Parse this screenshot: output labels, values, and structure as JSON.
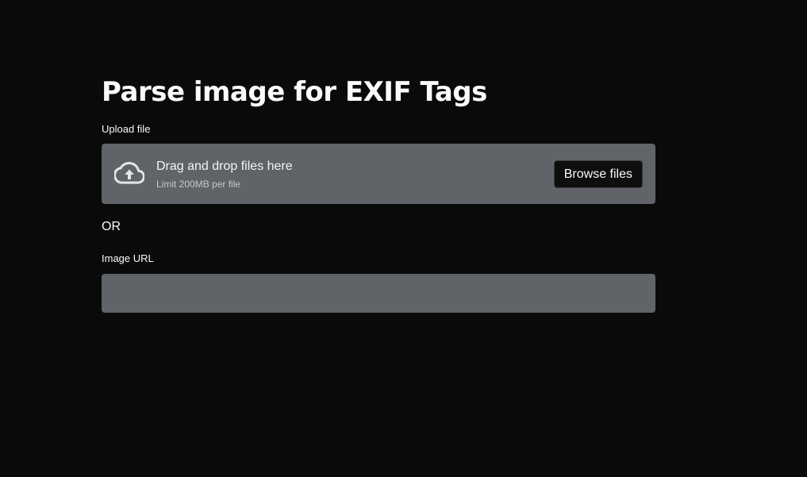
{
  "page": {
    "title": "Parse image for EXIF Tags"
  },
  "upload": {
    "label": "Upload file",
    "dropzone_title": "Drag and drop files here",
    "dropzone_subtitle": "Limit 200MB per file",
    "browse_label": "Browse files",
    "icon": "cloud-upload-icon"
  },
  "separator": {
    "text": "OR"
  },
  "image_url": {
    "label": "Image URL",
    "value": "",
    "placeholder": ""
  },
  "colors": {
    "background": "#0a0a0a",
    "field_background": "#606367",
    "button_background": "#0e0e0e",
    "text": "#fafafa"
  }
}
